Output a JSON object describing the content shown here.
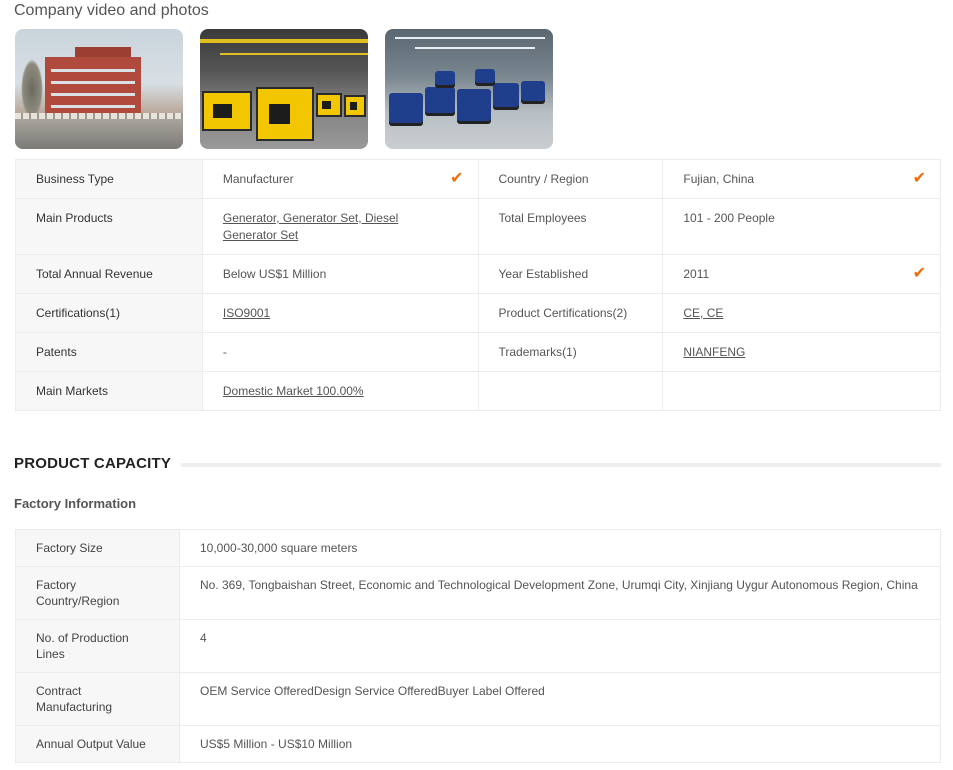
{
  "section_title": "Company video and photos",
  "photos": [
    {
      "name": "factory-building-photo"
    },
    {
      "name": "yellow-generators-photo"
    },
    {
      "name": "blue-engines-photo"
    }
  ],
  "info": {
    "business_type_label": "Business Type",
    "business_type_value": "Manufacturer",
    "country_label": "Country / Region",
    "country_value": "Fujian, China",
    "main_products_label": "Main Products",
    "main_products_value_1": "Generator, Generator Set, Diesel",
    "main_products_value_2": "Generator Set",
    "total_employees_label": "Total Employees",
    "total_employees_value": "101 - 200 People",
    "revenue_label": "Total Annual Revenue",
    "revenue_value": "Below US$1 Million",
    "year_label": "Year Established",
    "year_value": "2011",
    "certifications_label": "Certifications(1)",
    "certifications_value": "ISO9001",
    "product_cert_label": "Product Certifications(2)",
    "product_cert_value": "CE, CE",
    "patents_label": "Patents",
    "patents_value": "-",
    "trademarks_label": "Trademarks(1)",
    "trademarks_value": "NIANFENG",
    "markets_label": "Main Markets",
    "markets_value": "Domestic Market 100.00%",
    "check_glyph": "✔"
  },
  "capacity": {
    "title": "PRODUCT CAPACITY",
    "factory_info_title": "Factory Information",
    "rows": [
      {
        "label": "Factory Size",
        "value": "10,000-30,000 square meters"
      },
      {
        "label_1": "Factory",
        "label_2": "Country/Region",
        "value": "No. 369, Tongbaishan Street, Economic and Technological Development Zone, Urumqi City, Xinjiang Uygur Autonomous Region, China"
      },
      {
        "label_1": "No. of Production",
        "label_2": "Lines",
        "value": "4"
      },
      {
        "label_1": "Contract",
        "label_2": "Manufacturing",
        "value": "OEM Service OfferedDesign Service OfferedBuyer Label Offered"
      },
      {
        "label": "Annual Output Value",
        "value": "US$5 Million - US$10 Million"
      }
    ]
  },
  "colors": {
    "check": "#f26b0a",
    "label_bg": "#f7f7f7",
    "border": "#ececec"
  }
}
